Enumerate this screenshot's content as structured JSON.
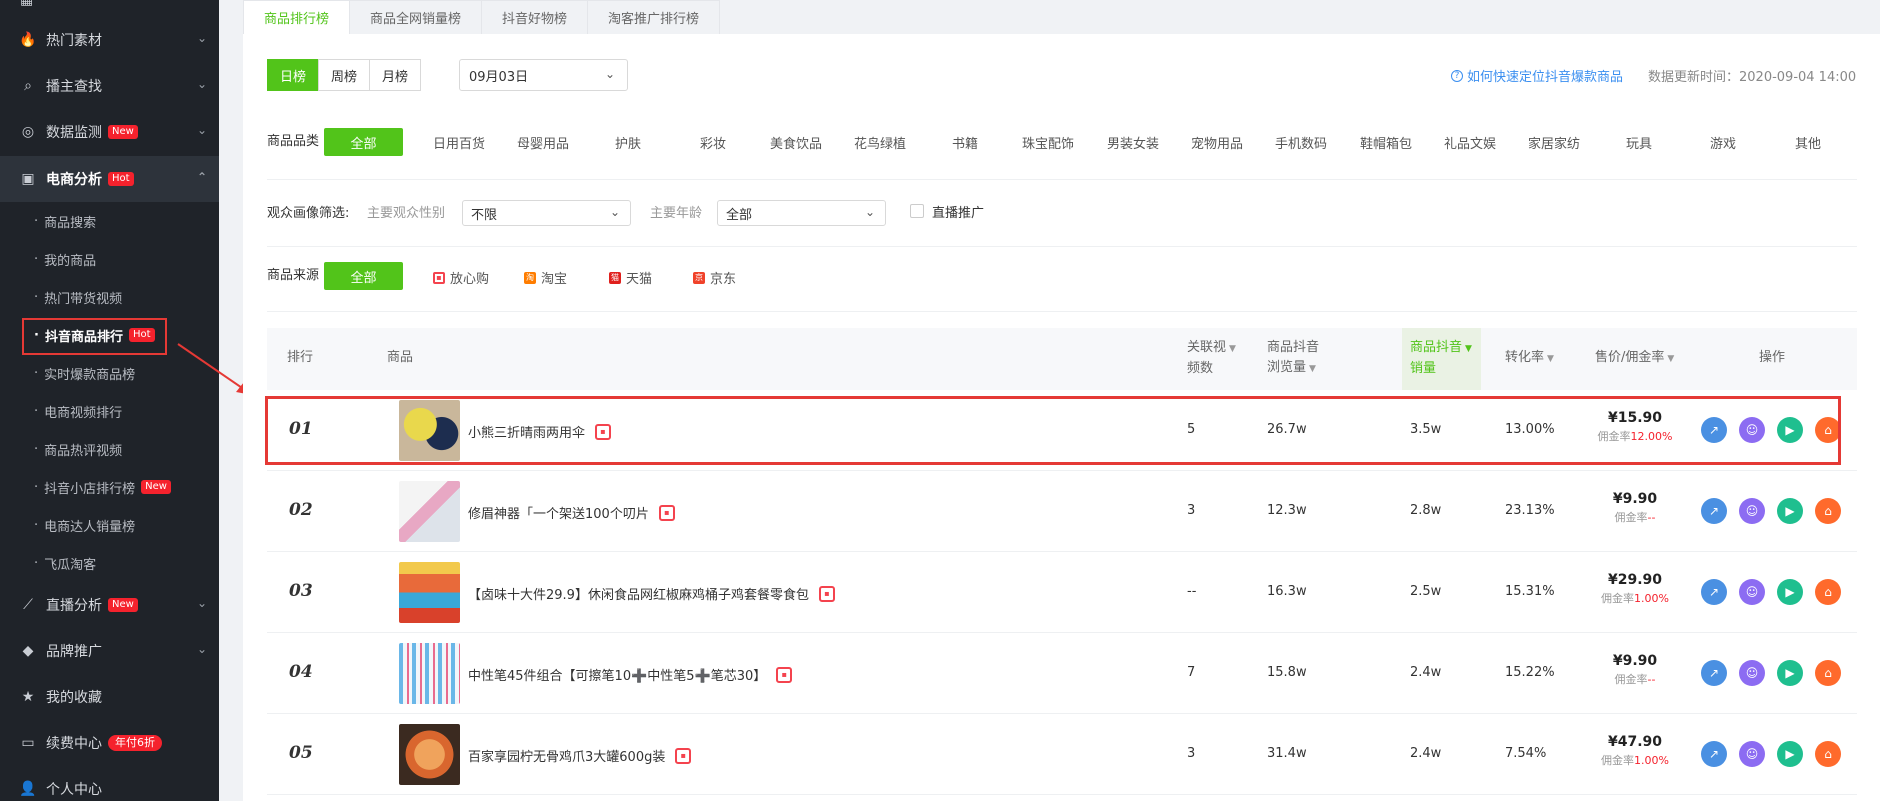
{
  "sidebar": {
    "items": [
      {
        "label": "热门素材",
        "icon": "fire-icon"
      },
      {
        "label": "播主查找",
        "icon": "search-icon"
      },
      {
        "label": "数据监测",
        "icon": "monitor-icon",
        "badge": "New"
      },
      {
        "label": "电商分析",
        "icon": "shopping-bag-icon",
        "badge": "Hot"
      }
    ],
    "sub_items": [
      "商品搜索",
      "我的商品",
      "热门带货视频",
      "抖音商品排行",
      "实时爆款商品榜",
      "电商视频排行",
      "商品热评视频",
      "抖音小店排行榜",
      "电商达人销量榜",
      "飞瓜淘客"
    ],
    "sub_badges": {
      "hot": "Hot",
      "new": "New"
    },
    "bottom_items": [
      {
        "label": "直播分析",
        "icon": "live-chart-icon",
        "badge": "New"
      },
      {
        "label": "品牌推广",
        "icon": "diamond-icon"
      },
      {
        "label": "我的收藏",
        "icon": "star-icon"
      },
      {
        "label": "续费中心",
        "icon": "wallet-icon",
        "badge": "年付6折"
      },
      {
        "label": "个人中心",
        "icon": "user-icon"
      }
    ]
  },
  "tabs": [
    "商品排行榜",
    "商品全网销量榜",
    "抖音好物榜",
    "淘客推广排行榜"
  ],
  "periods": [
    "日榜",
    "周榜",
    "月榜"
  ],
  "date": "09月03日",
  "help_link": "如何快速定位抖音爆款商品",
  "update_time": "数据更新时间：2020-09-04 14:00",
  "category": {
    "label": "商品品类",
    "options": [
      "全部",
      "日用百货",
      "母婴用品",
      "护肤",
      "彩妆",
      "美食饮品",
      "花鸟绿植",
      "书籍",
      "珠宝配饰",
      "男装女装",
      "宠物用品",
      "手机数码",
      "鞋帽箱包",
      "礼品文娱",
      "家居家纺",
      "玩具",
      "游戏",
      "其他"
    ]
  },
  "audience": {
    "label": "观众画像筛选:",
    "gender_label": "主要观众性别",
    "gender_value": "不限",
    "age_label": "主要年龄",
    "age_value": "全部",
    "live_label": "直播推广"
  },
  "source": {
    "label": "商品来源",
    "options": [
      "全部",
      "放心购",
      "淘宝",
      "天猫",
      "京东"
    ]
  },
  "table": {
    "headers": {
      "rank": "排行",
      "product": "商品",
      "videos_1": "关联视",
      "videos_2": "频数",
      "views_1": "商品抖音",
      "views_2": "浏览量",
      "sales_1": "商品抖音",
      "sales_2": "销量",
      "conv": "转化率",
      "price": "售价/佣金率",
      "ops": "操作"
    },
    "commission_label": "佣金率",
    "rows": [
      {
        "rank": "01",
        "name": "小熊三折晴雨两用伞",
        "videos": "5",
        "views": "26.7w",
        "sales": "3.5w",
        "conv": "13.00%",
        "price": "¥15.90",
        "commission": "12.00%"
      },
      {
        "rank": "02",
        "name": "修眉神器「一个架送100个叨片",
        "videos": "3",
        "views": "12.3w",
        "sales": "2.8w",
        "conv": "23.13%",
        "price": "¥9.90",
        "commission": "--"
      },
      {
        "rank": "03",
        "name": "【卤味十大件29.9】休闲食品网红椒麻鸡桶子鸡套餐零食包",
        "videos": "--",
        "views": "16.3w",
        "sales": "2.5w",
        "conv": "15.31%",
        "price": "¥29.90",
        "commission": "1.00%"
      },
      {
        "rank": "04",
        "name": "中性笔45件组合【可擦笔10➕中性笔5➕笔芯30】",
        "videos": "7",
        "views": "15.8w",
        "sales": "2.4w",
        "conv": "15.22%",
        "price": "¥9.90",
        "commission": "--"
      },
      {
        "rank": "05",
        "name": "百家享园柠无骨鸡爪3大罐600g装",
        "videos": "3",
        "views": "31.4w",
        "sales": "2.4w",
        "conv": "7.54%",
        "price": "¥47.90",
        "commission": "1.00%"
      }
    ]
  },
  "colors": {
    "accent": "#52c41a",
    "sidebar_bg": "#1f2329",
    "highlight": "#e53935"
  }
}
